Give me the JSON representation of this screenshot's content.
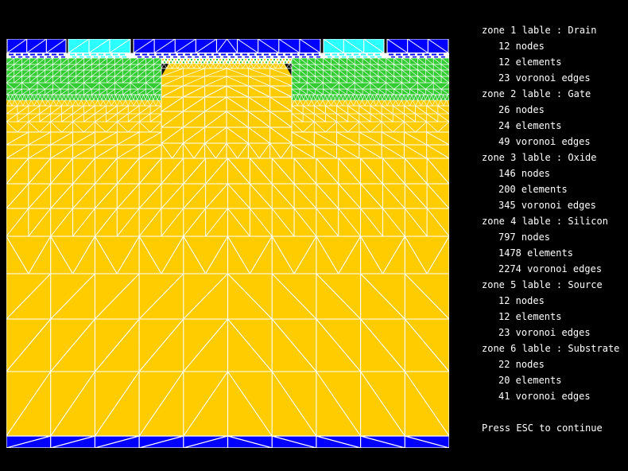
{
  "panel": {
    "zones": [
      {
        "title": "zone 1 lable : Drain",
        "stats": [
          "12 nodes",
          "12 elements",
          "23 voronoi edges"
        ]
      },
      {
        "title": "zone 2 lable : Gate",
        "stats": [
          "26 nodes",
          "24 elements",
          "49 voronoi edges"
        ]
      },
      {
        "title": "zone 3 lable : Oxide",
        "stats": [
          "146 nodes",
          "200 elements",
          "345 voronoi edges"
        ]
      },
      {
        "title": "zone 4 lable : Silicon",
        "stats": [
          "797 nodes",
          "1478 elements",
          "2274 voronoi edges"
        ]
      },
      {
        "title": "zone 5 lable : Source",
        "stats": [
          "12 nodes",
          "12 elements",
          "23 voronoi edges"
        ]
      },
      {
        "title": "zone 6 lable : Substrate",
        "stats": [
          "22 nodes",
          "20 elements",
          "41 voronoi edges"
        ]
      }
    ],
    "footer": "Press ESC to continue"
  },
  "mesh": {
    "colors": {
      "background": "#000000",
      "contact_blue": "#0000FF",
      "surface_cyan": "#2BFFFF",
      "oxide_green": "#33CC33",
      "silicon_yellow": "#FFCC00",
      "mesh_line_white": "#FFFFFF"
    },
    "legend_note": "blue=Drain/Gate/Source/Substrate contacts, cyan=surface oxide, green=Oxide, yellow=Silicon"
  }
}
